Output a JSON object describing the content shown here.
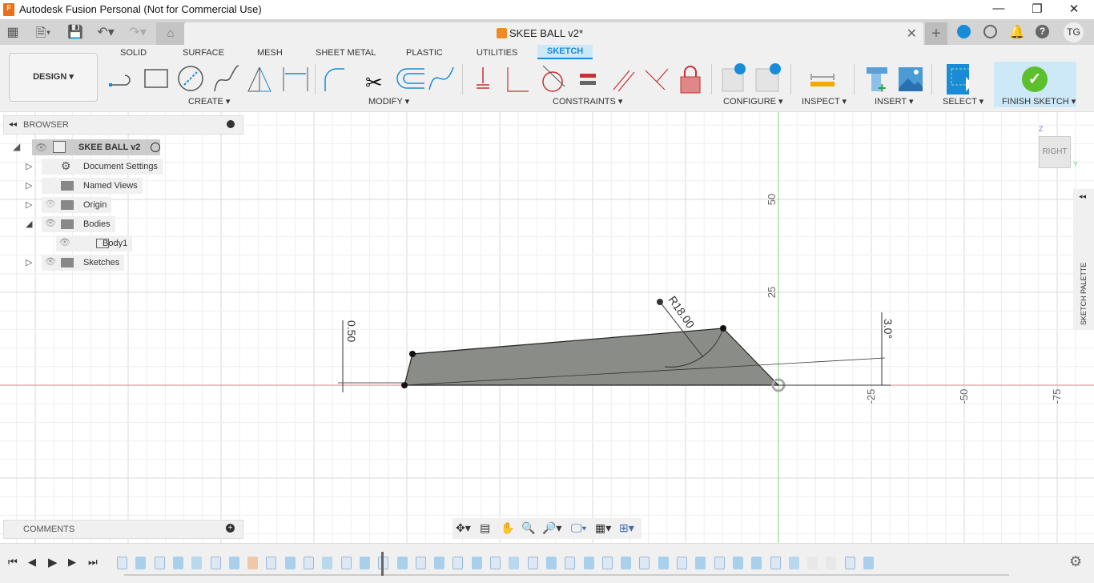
{
  "window": {
    "title": "Autodesk Fusion Personal (Not for Commercial Use)",
    "logo": "F"
  },
  "document": {
    "tab_name": "SKEE BALL v2*",
    "user_initials": "TG"
  },
  "ribbon": {
    "workspace": "DESIGN ▾",
    "tabs": [
      "SOLID",
      "SURFACE",
      "MESH",
      "SHEET METAL",
      "PLASTIC",
      "UTILITIES",
      "SKETCH"
    ],
    "active_tab": "SKETCH",
    "groups": [
      "CREATE ▾",
      "MODIFY ▾",
      "CONSTRAINTS ▾",
      "CONFIGURE ▾",
      "INSPECT ▾",
      "INSERT ▾",
      "SELECT ▾",
      "FINISH SKETCH ▾"
    ]
  },
  "browser": {
    "title": "BROWSER",
    "root": "SKEE BALL v2",
    "items": [
      {
        "label": "Document Settings",
        "icon": "gear-icon"
      },
      {
        "label": "Named Views",
        "icon": "folder-icon"
      },
      {
        "label": "Origin",
        "icon": "folder-icon"
      },
      {
        "label": "Bodies",
        "icon": "folder-icon"
      },
      {
        "label": "Body1",
        "icon": "body-icon"
      },
      {
        "label": "Sketches",
        "icon": "folder-icon"
      }
    ]
  },
  "comments": {
    "title": "COMMENTS"
  },
  "palette": {
    "label": "SKETCH PALETTE"
  },
  "viewcube": {
    "face": "RIGHT",
    "axis_z": "Z",
    "axis_y": "Y"
  },
  "canvas": {
    "vertical_ticks": [
      "50",
      "25"
    ],
    "horizontal_ticks": [
      "-25",
      "-50",
      "-75"
    ],
    "dimensions": {
      "height": "0.50",
      "radius": "R18.00",
      "angle": "3.0°"
    },
    "colors": {
      "x_axis": "#e08080",
      "y_axis": "#7ed67e",
      "profile_fill": "#8a8c88"
    }
  },
  "timeline": {
    "items": [
      "sketch",
      "body",
      "sketch",
      "body",
      "revolve",
      "sketch",
      "body",
      "loft",
      "sketch",
      "body",
      "sketch",
      "revolve",
      "sketch",
      "body",
      "sketch",
      "body",
      "sketch",
      "body",
      "sketch",
      "body",
      "sketch",
      "revolve",
      "sketch",
      "body",
      "sketch",
      "body",
      "sketch",
      "body",
      "sketch",
      "body",
      "sketch",
      "body",
      "sketch",
      "body",
      "shell",
      "sketch",
      "revolve",
      "fillet",
      "fillet",
      "sketch",
      "body"
    ]
  }
}
